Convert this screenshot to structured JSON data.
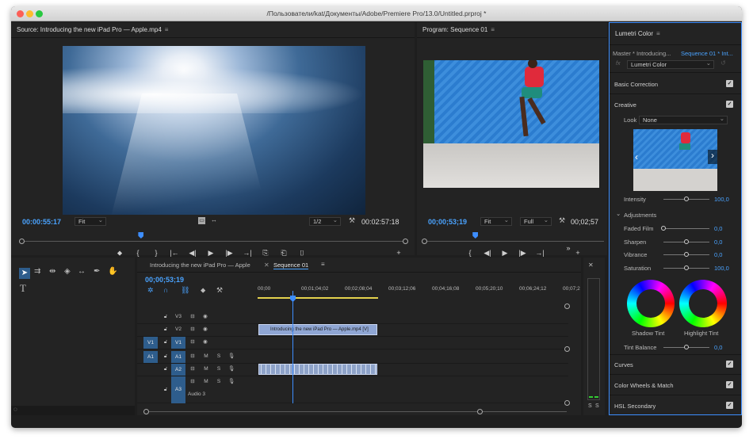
{
  "window": {
    "title": "/Пользователи/kat/Документы/Adobe/Premiere Pro/13.0/Untitled.prproj *"
  },
  "source": {
    "title": "Source: Introducing the new iPad Pro — Apple.mp4",
    "timecode": "00:00:55:17",
    "fit": "Fit",
    "resolution": "1/2",
    "duration": "00:02:57:18",
    "playhead_fraction": 0.31,
    "controls": [
      "⬥",
      "{",
      "}",
      "|←",
      "◀|",
      "▶",
      "|▶",
      "→|",
      "⎘",
      "⎗",
      "⌷",
      "+"
    ]
  },
  "program": {
    "title": "Program: Sequence 01",
    "timecode": "00;00;53;19",
    "fit": "Fit",
    "resolution": "Full",
    "duration": "00;02;57",
    "playhead_fraction": 0.28,
    "controls": [
      "{",
      "◀|",
      "▶",
      "|▶",
      "→|",
      "»",
      "+"
    ]
  },
  "timeline": {
    "tab_source": "Introducing the new iPad Pro — Apple",
    "tab_sequence": "Sequence 01",
    "timecode": "00;00;53;19",
    "ruler": [
      "00;00",
      "00;01;04;02",
      "00;02;08;04",
      "00;03;12;06",
      "00;04;16;08",
      "00;05;20;10",
      "00;06;24;12",
      "00;07;2"
    ],
    "tracks": {
      "v3": "V3",
      "v2": "V2",
      "v1": "V1",
      "v1_src": "V1",
      "a1": "A1",
      "a1_src": "A1",
      "a2": "A2",
      "a3": "A3",
      "m": "M",
      "s": "S",
      "audio3": "Audio 3"
    },
    "video_clip": "Introducing the new iPad Pro — Apple.mp4 [V]",
    "meter_labels": [
      "S",
      "S"
    ]
  },
  "lumetri": {
    "title": "Lumetri Color",
    "master": "Master * Introducing...",
    "sequence": "Sequence 01 * Int...",
    "effect": "Lumetri Color",
    "sections": {
      "basic": "Basic Correction",
      "creative": "Creative",
      "curves": "Curves",
      "wheels": "Color Wheels & Match",
      "hsl": "HSL Secondary"
    },
    "look_label": "Look",
    "look_value": "None",
    "intensity": {
      "label": "Intensity",
      "value": "100,0",
      "level": 0.5
    },
    "adjustments": "Adjustments",
    "sliders": [
      {
        "label": "Faded Film",
        "value": "0,0",
        "level": 0.0
      },
      {
        "label": "Sharpen",
        "value": "0,0",
        "level": 0.5
      },
      {
        "label": "Vibrance",
        "value": "0,0",
        "level": 0.5
      },
      {
        "label": "Saturation",
        "value": "100,0",
        "level": 0.5
      }
    ],
    "shadow_tint": "Shadow Tint",
    "highlight_tint": "Highlight Tint",
    "tint_balance": {
      "label": "Tint Balance",
      "value": "0,0",
      "level": 0.5
    }
  },
  "colors": {
    "accent": "#4aa3ff",
    "track_blue": "#2e5d8c",
    "clip": "#8fa6d4"
  }
}
